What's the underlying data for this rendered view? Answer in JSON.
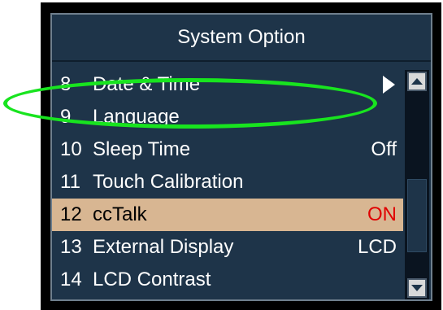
{
  "window": {
    "title": "System Option"
  },
  "menu": {
    "items": [
      {
        "number": "8",
        "label": "Date & Time",
        "value": "",
        "submenu": true,
        "selected": false
      },
      {
        "number": "9",
        "label": "Language",
        "value": "",
        "submenu": false,
        "selected": false
      },
      {
        "number": "10",
        "label": "Sleep Time",
        "value": "Off",
        "submenu": false,
        "selected": false
      },
      {
        "number": "11",
        "label": "Touch Calibration",
        "value": "",
        "submenu": false,
        "selected": false
      },
      {
        "number": "12",
        "label": "ccTalk",
        "value": "ON",
        "submenu": false,
        "selected": true
      },
      {
        "number": "13",
        "label": "External Display",
        "value": "LCD",
        "submenu": false,
        "selected": false
      },
      {
        "number": "14",
        "label": "LCD Contrast",
        "value": "",
        "submenu": false,
        "selected": false
      }
    ]
  },
  "scrollbar": {
    "up_icon": "chevron-up-icon",
    "down_icon": "chevron-down-icon"
  },
  "annotation": {
    "highlighted_item": "Language",
    "color": "#18e41f"
  },
  "colors": {
    "screen_background": "#1e3449",
    "selected_row": "#d8b692",
    "selected_value": "#e00000",
    "text": "#ffffff"
  }
}
